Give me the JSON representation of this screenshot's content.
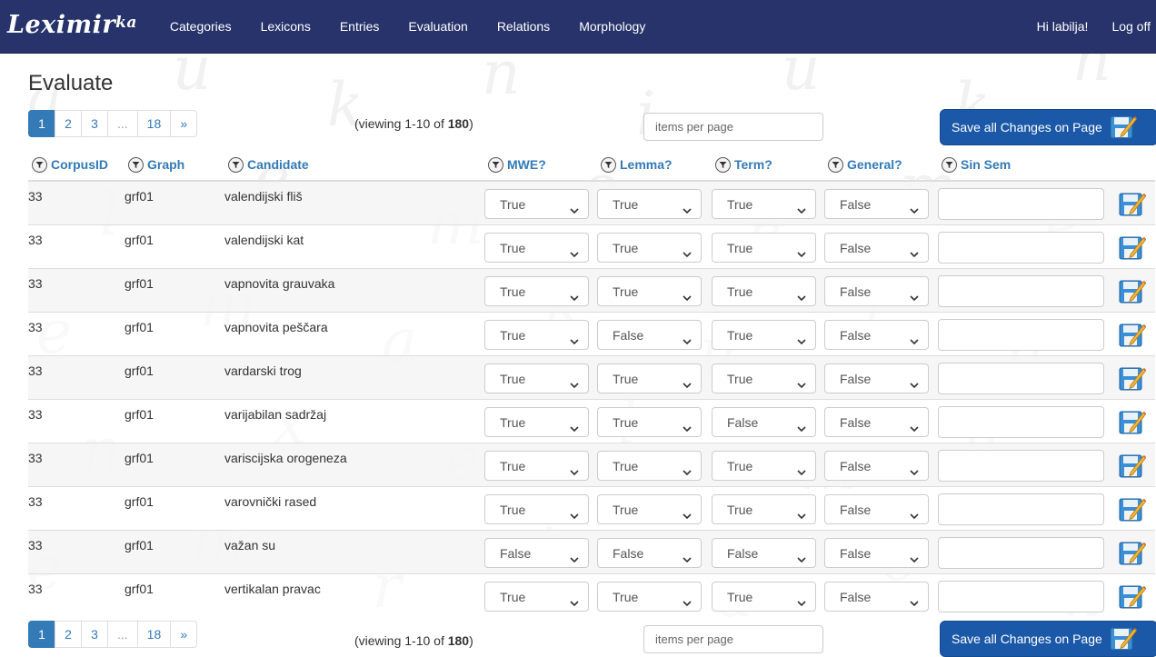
{
  "nav": {
    "brand": "Leximir",
    "brand_sup": "ka",
    "items": [
      "Categories",
      "Lexicons",
      "Entries",
      "Evaluation",
      "Relations",
      "Morphology"
    ],
    "greeting": "Hi labilja!",
    "logoff": "Log off"
  },
  "page": {
    "title": "Evaluate"
  },
  "pagination": {
    "pages": [
      "1",
      "2",
      "3",
      "...",
      "18",
      "»"
    ],
    "active": "1"
  },
  "viewing": {
    "prefix": "(viewing 1-10 of ",
    "total": "180",
    "suffix": ")"
  },
  "items_per_page": {
    "placeholder": "items per page"
  },
  "save_all_label": "Save all Changes on Page",
  "columns": [
    "CorpusID",
    "Graph",
    "Candidate",
    "MWE?",
    "Lemma?",
    "Term?",
    "General?",
    "Sin Sem"
  ],
  "rows": [
    {
      "corpus": "33",
      "graph": "grf01",
      "candidate": "valendijski fliš",
      "mwe": "True",
      "lemma": "True",
      "term": "True",
      "general": "False",
      "sinsem": ""
    },
    {
      "corpus": "33",
      "graph": "grf01",
      "candidate": "valendijski kat",
      "mwe": "True",
      "lemma": "True",
      "term": "True",
      "general": "False",
      "sinsem": ""
    },
    {
      "corpus": "33",
      "graph": "grf01",
      "candidate": "vapnovita grauvaka",
      "mwe": "True",
      "lemma": "True",
      "term": "True",
      "general": "False",
      "sinsem": ""
    },
    {
      "corpus": "33",
      "graph": "grf01",
      "candidate": "vapnovita peščara",
      "mwe": "True",
      "lemma": "False",
      "term": "True",
      "general": "False",
      "sinsem": ""
    },
    {
      "corpus": "33",
      "graph": "grf01",
      "candidate": "vardarski trog",
      "mwe": "True",
      "lemma": "True",
      "term": "True",
      "general": "False",
      "sinsem": ""
    },
    {
      "corpus": "33",
      "graph": "grf01",
      "candidate": "varijabilan sadržaj",
      "mwe": "True",
      "lemma": "True",
      "term": "False",
      "general": "False",
      "sinsem": ""
    },
    {
      "corpus": "33",
      "graph": "grf01",
      "candidate": "variscijska orogeneza",
      "mwe": "True",
      "lemma": "True",
      "term": "True",
      "general": "False",
      "sinsem": ""
    },
    {
      "corpus": "33",
      "graph": "grf01",
      "candidate": "varovnički rased",
      "mwe": "True",
      "lemma": "True",
      "term": "True",
      "general": "False",
      "sinsem": ""
    },
    {
      "corpus": "33",
      "graph": "grf01",
      "candidate": "važan su",
      "mwe": "False",
      "lemma": "False",
      "term": "False",
      "general": "False",
      "sinsem": ""
    },
    {
      "corpus": "33",
      "graph": "grf01",
      "candidate": "vertikalan pravac",
      "mwe": "True",
      "lemma": "True",
      "term": "True",
      "general": "False",
      "sinsem": ""
    }
  ],
  "colors": {
    "navbar": "#27336a",
    "link": "#337ab7",
    "save_button": "#1b58a8"
  },
  "icons": {
    "filter": "filter-icon",
    "save": "save-edit-icon",
    "chevron": "chevron-down-icon"
  }
}
